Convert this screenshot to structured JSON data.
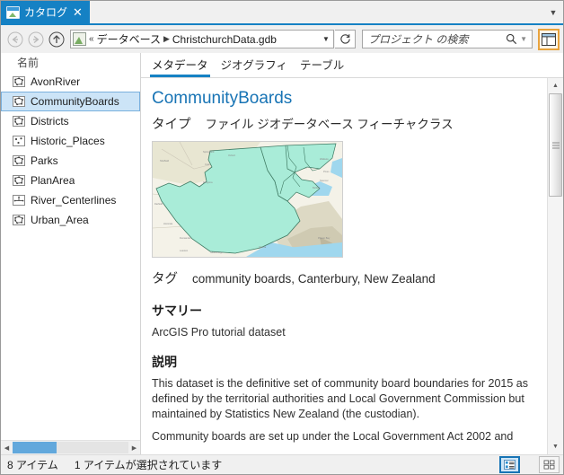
{
  "tab": {
    "label": "カタログ",
    "close": "✕",
    "icon": "catalog-icon",
    "overflow_chevron": "▼"
  },
  "nav": {
    "back": "back-arrow-icon",
    "forward": "forward-arrow-icon",
    "up": "up-arrow-icon",
    "refresh": "refresh-icon",
    "address_icon": "geodatabase-icon",
    "overflow": "«",
    "crumbs": [
      "データベース",
      "ChristchurchData.gdb"
    ],
    "separator": "▶",
    "dropdown_caret": "▼"
  },
  "search": {
    "placeholder": "プロジェクト の検索",
    "value": "",
    "icon": "search-icon",
    "caret": "▼"
  },
  "toolbar": {
    "layout_button": "panel-layout-icon",
    "highlight_color": "#e8a33d"
  },
  "tree": {
    "column_header": "名前",
    "items": [
      {
        "label": "AvonRiver",
        "icon": "polygon-feature-icon",
        "selected": false
      },
      {
        "label": "CommunityBoards",
        "icon": "polygon-feature-icon",
        "selected": true
      },
      {
        "label": "Districts",
        "icon": "polygon-feature-icon",
        "selected": false
      },
      {
        "label": "Historic_Places",
        "icon": "point-feature-icon",
        "selected": false
      },
      {
        "label": "Parks",
        "icon": "polygon-feature-icon",
        "selected": false
      },
      {
        "label": "PlanArea",
        "icon": "polygon-feature-icon",
        "selected": false
      },
      {
        "label": "River_Centerlines",
        "icon": "line-feature-icon",
        "selected": false
      },
      {
        "label": "Urban_Area",
        "icon": "polygon-feature-icon",
        "selected": false
      }
    ],
    "hscroll": {
      "left_arrow": "◀",
      "right_arrow": "▶"
    }
  },
  "meta": {
    "tabs": [
      {
        "label": "メタデータ",
        "active": true
      },
      {
        "label": "ジオグラフィ",
        "active": false
      },
      {
        "label": "テーブル",
        "active": false
      }
    ],
    "title": "CommunityBoards",
    "title_color": "#1874b5",
    "type_key": "タイプ",
    "type_value": "ファイル ジオデータベース フィーチャクラス",
    "thumbnail": "map-thumbnail",
    "tags_key": "タグ",
    "tags_value": "community boards, Canterbury, New Zealand",
    "summary_heading": "サマリー",
    "summary_body": "ArcGIS Pro tutorial dataset",
    "description_heading": "説明",
    "description_para1": "This dataset is the definitive set of community board boundaries for 2015 as defined by the territorial authorities and Local Government Commission but maintained by Statistics New Zealand (the custodian).",
    "description_para2": "Community boards are set up under the Local Government Act 2002 and"
  },
  "scrollbar": {
    "up_arrow": "▲",
    "down_arrow": "▼"
  },
  "status": {
    "item_count": "8 アイテム",
    "selection": "1 アイテムが選択されています",
    "list_view_icon": "list-view-icon",
    "tile_view_icon": "tile-view-icon"
  }
}
